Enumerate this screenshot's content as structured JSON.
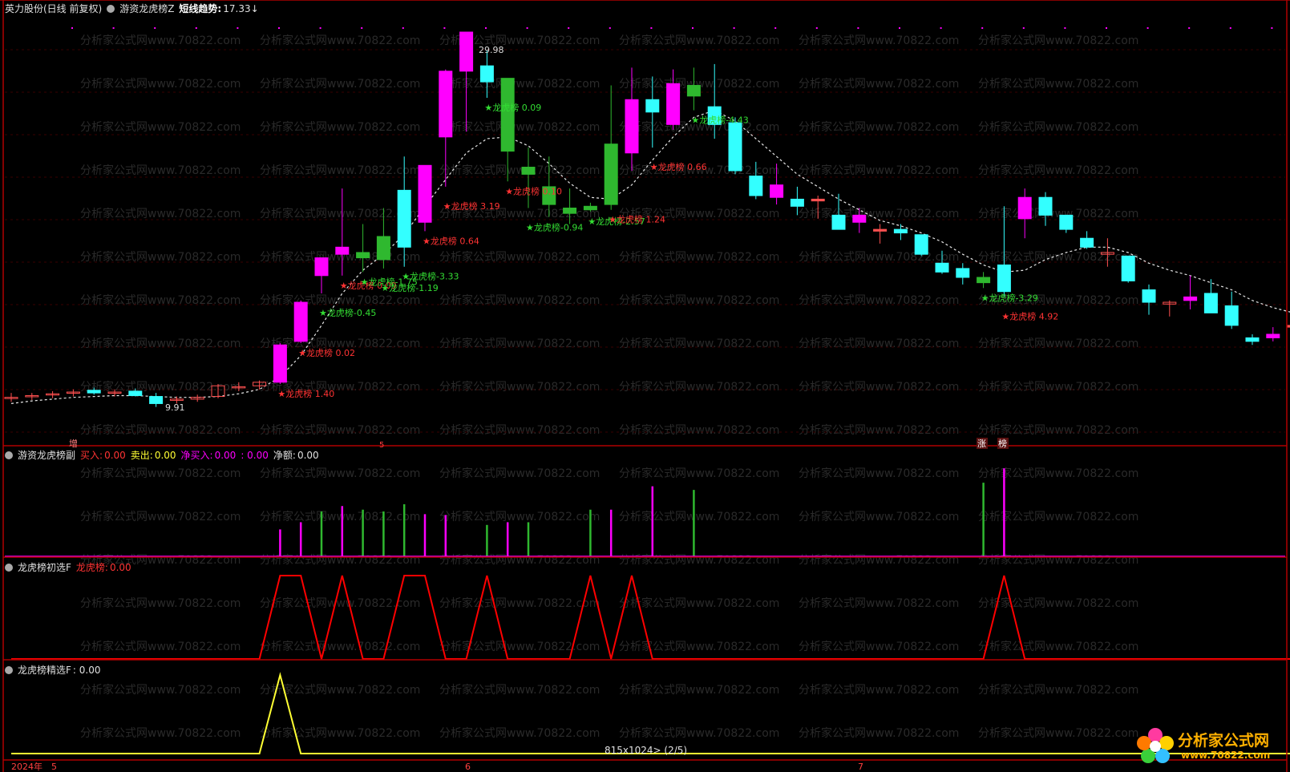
{
  "colors": {
    "background": "#000000",
    "up": "#ff00ff",
    "down_green": "#2fb82f",
    "down_cyan": "#33ffff",
    "flat": "#ff5050",
    "ma": "#e6e6e6",
    "label_up": "#ff3333",
    "label_down": "#33dd33",
    "red_line": "#ff0000",
    "yellow_line": "#ffff33",
    "border": "#b00000",
    "watermark": "#2a2a2a"
  },
  "main_header": {
    "stock": "英力股份(日线 前复权)",
    "indicator": "游资龙虎榜Z",
    "trend_label": "短线趋势:",
    "trend_value": "17.33↓"
  },
  "sub1_header": {
    "name": "游资龙虎榜副",
    "buy_label": "买入:",
    "buy_value": "0.00",
    "sell_label": "卖出:",
    "sell_value": "0.00",
    "net_buy_label": "净买入:",
    "net_buy_value": "0.00",
    "net_buy_value2": ": 0.00",
    "net_label": "净额:",
    "net_value": "0.00"
  },
  "sub2_header": {
    "name": "龙虎榜初选F",
    "label": "龙虎榜:",
    "value": "0.00"
  },
  "sub3_header": {
    "name": "龙虎榜精选F",
    "value": ": 0.00"
  },
  "bottom_bar": {
    "year": "2024年",
    "month_5": "5",
    "month_6": "6",
    "month_7": "7",
    "zoom_info": "815x1024> (2/5)"
  },
  "markers": {
    "zeng": "增",
    "zhang": "涨",
    "bang": "榜",
    "wu": "5"
  },
  "watermark_text": "分析家公式网www.70822.com",
  "logo": {
    "title": "分析家公式网",
    "url": "www.70822.com",
    "icon": "flower-logo-icon"
  },
  "chart_data": [
    {
      "type": "candlestick",
      "title": "英力股份(日线 前复权)",
      "price_range": [
        8,
        31
      ],
      "high_annotation": "29.98",
      "low_annotation": "9.91",
      "candles": [
        {
          "o": 10.4,
          "h": 10.7,
          "l": 10.2,
          "c": 10.45
        },
        {
          "o": 10.5,
          "h": 10.7,
          "l": 10.3,
          "c": 10.55
        },
        {
          "o": 10.6,
          "h": 10.8,
          "l": 10.4,
          "c": 10.65
        },
        {
          "o": 10.7,
          "h": 10.9,
          "l": 10.5,
          "c": 10.75
        },
        {
          "o": 10.85,
          "h": 11.0,
          "l": 10.6,
          "c": 10.7
        },
        {
          "o": 10.7,
          "h": 10.9,
          "l": 10.5,
          "c": 10.75
        },
        {
          "o": 10.8,
          "h": 10.95,
          "l": 10.5,
          "c": 10.55
        },
        {
          "o": 10.5,
          "h": 10.7,
          "l": 9.91,
          "c": 10.1
        },
        {
          "o": 10.3,
          "h": 10.5,
          "l": 10.1,
          "c": 10.35
        },
        {
          "o": 10.35,
          "h": 10.6,
          "l": 10.2,
          "c": 10.45
        },
        {
          "o": 10.5,
          "h": 11.2,
          "l": 10.4,
          "c": 11.1
        },
        {
          "o": 11.0,
          "h": 11.3,
          "l": 10.8,
          "c": 11.05
        },
        {
          "o": 11.1,
          "h": 11.4,
          "l": 10.9,
          "c": 11.3
        },
        {
          "o": 11.3,
          "h": 13.5,
          "l": 11.2,
          "c": 13.4
        },
        {
          "o": 13.6,
          "h": 15.9,
          "l": 13.5,
          "c": 15.8
        },
        {
          "o": 17.3,
          "h": 18.3,
          "l": 16.3,
          "c": 18.3
        },
        {
          "o": 18.5,
          "h": 22.2,
          "l": 17.3,
          "c": 18.9
        },
        {
          "o": 18.6,
          "h": 20.2,
          "l": 17.5,
          "c": 18.3
        },
        {
          "o": 19.5,
          "h": 21.1,
          "l": 17.7,
          "c": 18.2
        },
        {
          "o": 22.1,
          "h": 24.0,
          "l": 17.8,
          "c": 18.9
        },
        {
          "o": 20.3,
          "h": 23.5,
          "l": 19.8,
          "c": 23.5
        },
        {
          "o": 25.1,
          "h": 28.9,
          "l": 22.3,
          "c": 28.8
        },
        {
          "o": 28.8,
          "h": 30.0,
          "l": 25.4,
          "c": 31.0
        },
        {
          "o": 29.1,
          "h": 29.98,
          "l": 27.3,
          "c": 28.2
        },
        {
          "o": 28.4,
          "h": 28.4,
          "l": 22.6,
          "c": 24.3
        },
        {
          "o": 23.4,
          "h": 24.5,
          "l": 21.1,
          "c": 23.0
        },
        {
          "o": 22.3,
          "h": 24.0,
          "l": 20.6,
          "c": 21.3
        },
        {
          "o": 21.1,
          "h": 22.2,
          "l": 20.2,
          "c": 20.8
        },
        {
          "o": 21.2,
          "h": 21.4,
          "l": 20.9,
          "c": 21.0
        },
        {
          "o": 24.7,
          "h": 28.0,
          "l": 21.0,
          "c": 21.3
        },
        {
          "o": 24.2,
          "h": 29.0,
          "l": 23.2,
          "c": 27.2
        },
        {
          "o": 27.2,
          "h": 28.5,
          "l": 24.5,
          "c": 26.5
        },
        {
          "o": 25.8,
          "h": 28.9,
          "l": 25.5,
          "c": 28.1
        },
        {
          "o": 28.0,
          "h": 29.0,
          "l": 26.6,
          "c": 27.4
        },
        {
          "o": 26.8,
          "h": 29.2,
          "l": 25.0,
          "c": 25.8
        },
        {
          "o": 25.9,
          "h": 26.2,
          "l": 23.0,
          "c": 23.2
        },
        {
          "o": 22.9,
          "h": 23.7,
          "l": 21.6,
          "c": 21.8
        },
        {
          "o": 21.7,
          "h": 23.6,
          "l": 21.3,
          "c": 22.4
        },
        {
          "o": 21.6,
          "h": 22.3,
          "l": 20.7,
          "c": 21.2
        },
        {
          "o": 21.6,
          "h": 21.8,
          "l": 20.5,
          "c": 21.5
        },
        {
          "o": 20.7,
          "h": 21.9,
          "l": 20.6,
          "c": 19.9
        },
        {
          "o": 20.3,
          "h": 21.1,
          "l": 19.7,
          "c": 20.7
        },
        {
          "o": 19.9,
          "h": 20.2,
          "l": 19.1,
          "c": 19.8
        },
        {
          "o": 19.9,
          "h": 20.2,
          "l": 19.3,
          "c": 19.7
        },
        {
          "o": 19.6,
          "h": 19.6,
          "l": 18.4,
          "c": 18.5
        },
        {
          "o": 18.0,
          "h": 18.7,
          "l": 17.4,
          "c": 17.5
        },
        {
          "o": 17.7,
          "h": 18.0,
          "l": 16.8,
          "c": 17.2
        },
        {
          "o": 17.2,
          "h": 17.5,
          "l": 16.6,
          "c": 16.9
        },
        {
          "o": 17.9,
          "h": 21.2,
          "l": 16.1,
          "c": 16.4
        },
        {
          "o": 20.5,
          "h": 22.2,
          "l": 19.4,
          "c": 21.7
        },
        {
          "o": 21.7,
          "h": 22.0,
          "l": 20.1,
          "c": 20.7
        },
        {
          "o": 20.7,
          "h": 20.7,
          "l": 19.7,
          "c": 19.9
        },
        {
          "o": 19.4,
          "h": 19.8,
          "l": 18.8,
          "c": 18.9
        },
        {
          "o": 18.5,
          "h": 19.4,
          "l": 17.8,
          "c": 18.6
        },
        {
          "o": 18.4,
          "h": 18.4,
          "l": 16.9,
          "c": 17.0
        },
        {
          "o": 16.5,
          "h": 16.8,
          "l": 15.1,
          "c": 15.8
        },
        {
          "o": 15.7,
          "h": 15.9,
          "l": 15.0,
          "c": 15.8
        },
        {
          "o": 15.9,
          "h": 17.3,
          "l": 15.4,
          "c": 16.1
        },
        {
          "o": 16.3,
          "h": 17.1,
          "l": 15.3,
          "c": 15.2
        },
        {
          "o": 15.6,
          "h": 16.4,
          "l": 14.3,
          "c": 14.5
        },
        {
          "o": 13.8,
          "h": 14.0,
          "l": 13.4,
          "c": 13.6
        },
        {
          "o": 13.8,
          "h": 14.4,
          "l": 13.6,
          "c": 14.0
        },
        {
          "o": 14.5,
          "h": 15.0,
          "l": 14.1,
          "c": 14.4
        }
      ],
      "ma_series_name": "短线趋势",
      "ma": [
        10.1,
        10.25,
        10.35,
        10.45,
        10.5,
        10.55,
        10.55,
        10.5,
        10.45,
        10.45,
        10.5,
        10.65,
        10.9,
        11.6,
        12.8,
        14.5,
        16.3,
        17.6,
        18.5,
        19.6,
        21.2,
        22.7,
        24.2,
        25.0,
        25.1,
        24.6,
        23.6,
        22.5,
        21.7,
        21.6,
        22.4,
        23.8,
        25.1,
        26.2,
        26.6,
        26.0,
        25.0,
        24.0,
        23.0,
        22.3,
        21.6,
        21.0,
        20.4,
        20.1,
        19.7,
        19.2,
        18.5,
        17.9,
        17.5,
        17.6,
        18.2,
        18.6,
        18.9,
        18.9,
        18.6,
        18.0,
        17.6,
        17.3,
        16.9,
        16.5,
        15.9,
        15.5,
        15.2
      ],
      "annotations": [
        {
          "i": 13,
          "text": "龙虎榜 1.40",
          "kind": "up"
        },
        {
          "i": 14,
          "text": "龙虎榜 0.02",
          "kind": "up"
        },
        {
          "i": 15,
          "text": "龙虎榜-0.45",
          "kind": "down"
        },
        {
          "i": 16,
          "text": "龙虎榜 0.09",
          "kind": "up"
        },
        {
          "i": 17,
          "text": "龙虎榜-1.75",
          "kind": "down"
        },
        {
          "i": 18,
          "text": "龙虎榜-1.19",
          "kind": "down"
        },
        {
          "i": 19,
          "text": "龙虎榜-3.33",
          "kind": "down"
        },
        {
          "i": 20,
          "text": "龙虎榜 0.64",
          "kind": "up"
        },
        {
          "i": 21,
          "text": "龙虎榜 3.19",
          "kind": "up"
        },
        {
          "i": 23,
          "text": "龙虎榜 0.09",
          "kind": "down"
        },
        {
          "i": 24,
          "text": "龙虎榜 0.10",
          "kind": "up"
        },
        {
          "i": 25,
          "text": "龙虎榜-0.94",
          "kind": "down"
        },
        {
          "i": 28,
          "text": "龙虎榜-2.57",
          "kind": "down"
        },
        {
          "i": 29,
          "text": "龙虎榜 1.24",
          "kind": "up"
        },
        {
          "i": 31,
          "text": "龙虎榜 0.66",
          "kind": "up"
        },
        {
          "i": 33,
          "text": "龙虎榜-4.43",
          "kind": "down"
        },
        {
          "i": 47,
          "text": "龙虎榜-3.29",
          "kind": "down"
        },
        {
          "i": 48,
          "text": "龙虎榜 4.92",
          "kind": "up"
        }
      ]
    },
    {
      "type": "bar",
      "title": "游资龙虎榜副",
      "bars": [
        {
          "i": 13,
          "v": 0.3,
          "kind": "up"
        },
        {
          "i": 14,
          "v": 0.38,
          "kind": "up"
        },
        {
          "i": 15,
          "v": 0.5,
          "kind": "down"
        },
        {
          "i": 16,
          "v": 0.56,
          "kind": "up"
        },
        {
          "i": 17,
          "v": 0.52,
          "kind": "down"
        },
        {
          "i": 18,
          "v": 0.5,
          "kind": "down"
        },
        {
          "i": 19,
          "v": 0.58,
          "kind": "down"
        },
        {
          "i": 20,
          "v": 0.47,
          "kind": "up"
        },
        {
          "i": 21,
          "v": 0.46,
          "kind": "up"
        },
        {
          "i": 23,
          "v": 0.35,
          "kind": "down"
        },
        {
          "i": 24,
          "v": 0.38,
          "kind": "up"
        },
        {
          "i": 25,
          "v": 0.38,
          "kind": "down"
        },
        {
          "i": 28,
          "v": 0.52,
          "kind": "down"
        },
        {
          "i": 29,
          "v": 0.52,
          "kind": "up"
        },
        {
          "i": 31,
          "v": 0.78,
          "kind": "up"
        },
        {
          "i": 33,
          "v": 0.74,
          "kind": "down"
        },
        {
          "i": 47,
          "v": 0.82,
          "kind": "down"
        },
        {
          "i": 48,
          "v": 0.98,
          "kind": "up"
        }
      ]
    },
    {
      "type": "line",
      "title": "龙虎榜初选F",
      "values": [
        0,
        0,
        0,
        0,
        0,
        0,
        0,
        0,
        0,
        0,
        0,
        0,
        0,
        1,
        1,
        0,
        1,
        0,
        0,
        1,
        1,
        0,
        0,
        1,
        0,
        0,
        0,
        0,
        1,
        0,
        1,
        0,
        0,
        0,
        0,
        0,
        0,
        0,
        0,
        0,
        0,
        0,
        0,
        0,
        0,
        0,
        0,
        0,
        1,
        0,
        0,
        0,
        0,
        0,
        0,
        0,
        0,
        0,
        0,
        0,
        0,
        0,
        0
      ]
    },
    {
      "type": "line",
      "title": "龙虎榜精选F",
      "values": [
        0,
        0,
        0,
        0,
        0,
        0,
        0,
        0,
        0,
        0,
        0,
        0,
        0,
        1,
        0,
        0,
        0,
        0,
        0,
        0,
        0,
        0,
        0,
        0,
        0,
        0,
        0,
        0,
        0,
        0,
        0,
        0,
        0,
        0,
        0,
        0,
        0,
        0,
        0,
        0,
        0,
        0,
        0,
        0,
        0,
        0,
        0,
        0,
        0,
        0,
        0,
        0,
        0,
        0,
        0,
        0,
        0,
        0,
        0,
        0,
        0,
        0,
        0
      ]
    }
  ]
}
